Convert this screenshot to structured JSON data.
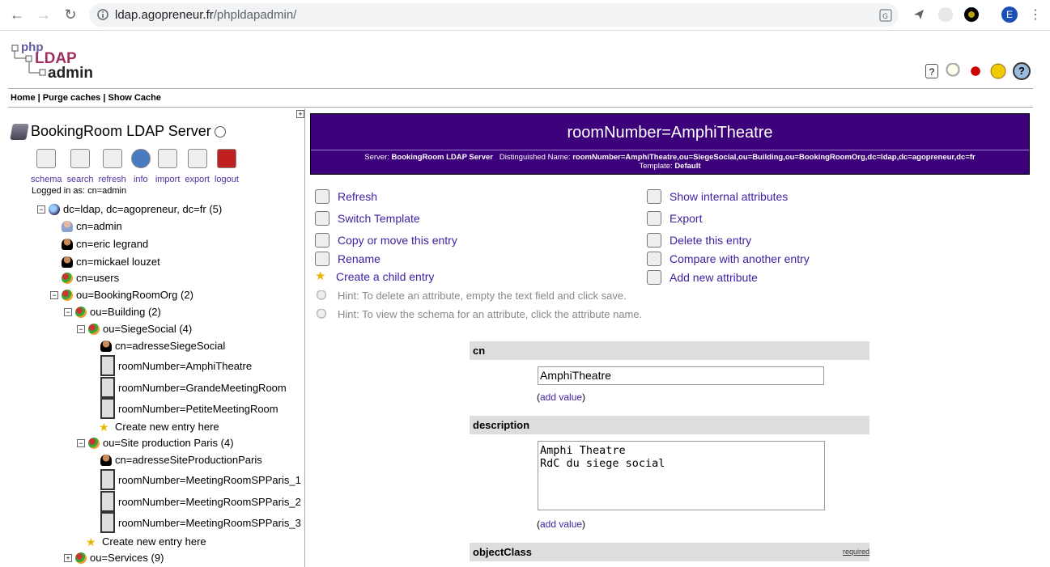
{
  "browser": {
    "url_host": "ldap.agopreneur.fr",
    "url_path": "/phpldapadmin/",
    "profile_initial": "E"
  },
  "logo": {
    "line1": "php",
    "line2": "LDAP",
    "line3": "admin"
  },
  "menu": {
    "home": "Home",
    "purge": "Purge caches",
    "show_cache": "Show Cache",
    "sep": "|"
  },
  "server": {
    "name": "BookingRoom LDAP Server",
    "logged_in": "Logged in as: cn=admin"
  },
  "tools": [
    {
      "label": "schema",
      "icon": "schema-icon"
    },
    {
      "label": "search",
      "icon": "search-icon"
    },
    {
      "label": "refresh",
      "icon": "refresh-icon"
    },
    {
      "label": "info",
      "icon": "info-icon"
    },
    {
      "label": "import",
      "icon": "import-icon"
    },
    {
      "label": "export",
      "icon": "export-icon"
    },
    {
      "label": "logout",
      "icon": "logout-icon"
    }
  ],
  "tree": [
    {
      "text": "dc=ldap, dc=agopreneur, dc=fr",
      "count": "(5)"
    },
    {
      "text": "cn=admin"
    },
    {
      "text": "cn=eric legrand"
    },
    {
      "text": "cn=mickael louzet"
    },
    {
      "text": "cn=users"
    },
    {
      "text": "ou=BookingRoomOrg",
      "count": "(2)"
    },
    {
      "text": "ou=Building",
      "count": "(2)"
    },
    {
      "text": "ou=SiegeSocial",
      "count": "(4)"
    },
    {
      "text": "cn=adresseSiegeSocial"
    },
    {
      "text": "roomNumber=AmphiTheatre"
    },
    {
      "text": "roomNumber=GrandeMeetingRoom"
    },
    {
      "text": "roomNumber=PetiteMeetingRoom"
    },
    {
      "text": "Create new entry here"
    },
    {
      "text": "ou=Site production Paris",
      "count": "(4)"
    },
    {
      "text": "cn=adresseSiteProductionParis"
    },
    {
      "text": "roomNumber=MeetingRoomSPParis_1"
    },
    {
      "text": "roomNumber=MeetingRoomSPParis_2"
    },
    {
      "text": "roomNumber=MeetingRoomSPParis_3"
    },
    {
      "text": "Create new entry here"
    },
    {
      "text": "ou=Services",
      "count": "(9)"
    }
  ],
  "entry": {
    "title": "roomNumber=AmphiTheatre",
    "server_label": "Server:",
    "server_value": "BookingRoom LDAP Server",
    "dn_label": "Distinguished Name:",
    "dn_value": "roomNumber=AmphiTheatre,ou=SiegeSocial,ou=Building,ou=BookingRoomOrg,dc=ldap,dc=agopreneur,dc=fr",
    "template_label": "Template:",
    "template_value": "Default"
  },
  "actions": {
    "refresh": "Refresh",
    "switch_template": "Switch Template",
    "copy_move": "Copy or move this entry",
    "rename": "Rename",
    "create_child": "Create a child entry",
    "show_internal": "Show internal attributes",
    "export": "Export",
    "delete": "Delete this entry",
    "compare": "Compare with another entry",
    "add_attribute": "Add new attribute"
  },
  "hints": {
    "delete": "Hint: To delete an attribute, empty the text field and click save.",
    "schema": "Hint: To view the schema for an attribute, click the attribute name."
  },
  "attributes": {
    "cn_label": "cn",
    "cn_value": "AmphiTheatre",
    "description_label": "description",
    "description_line1": "Amphi Theatre",
    "description_line2": "RdC du siege social",
    "objectclass_label": "objectClass",
    "required": "required",
    "add_value": "add value"
  }
}
